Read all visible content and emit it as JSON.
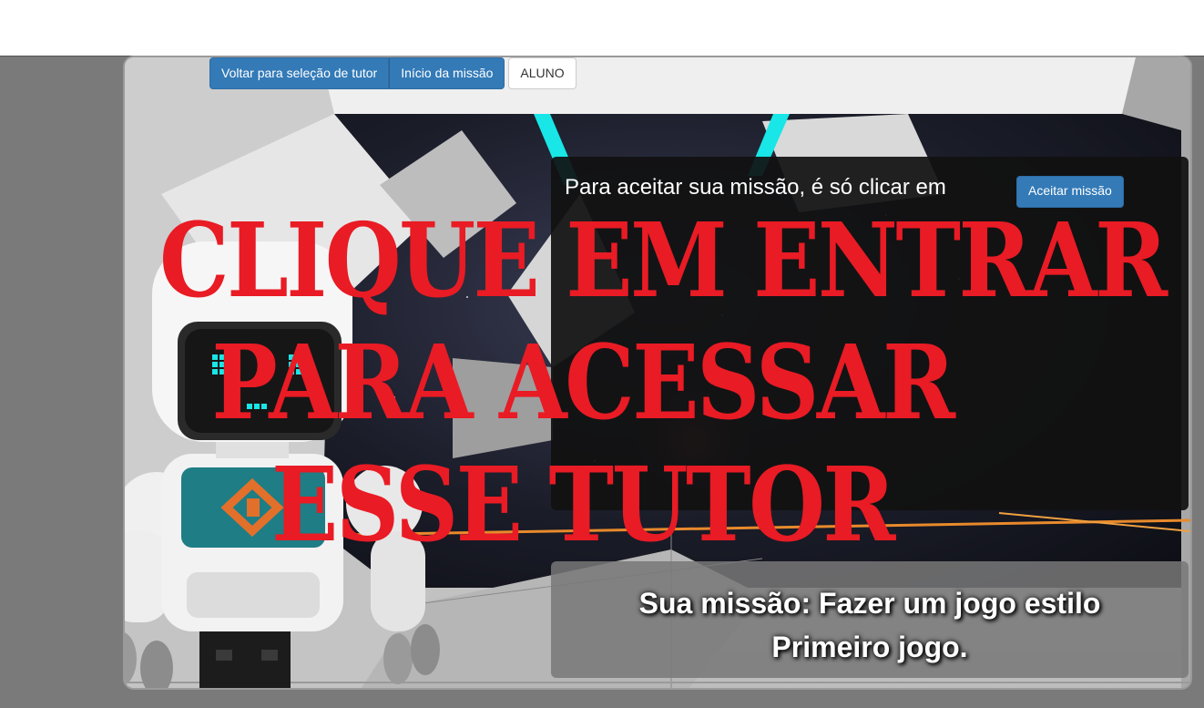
{
  "toolbar": {
    "back_label": "Voltar para seleção de tutor",
    "start_label": "Início da missão",
    "role_label": "ALUNO"
  },
  "accept": {
    "text": "Para aceitar sua missão, é só clicar em",
    "button_label": "Aceitar missão"
  },
  "mission": {
    "line1": "Sua missão: Fazer um jogo estilo",
    "line2": "Primeiro jogo."
  },
  "overlay": {
    "line1": "CLIQUE EM ENTRAR",
    "line2": "PARA ACESSAR",
    "line3": "ESSE TUTOR"
  },
  "colors": {
    "overlay_red": "#e91b24",
    "button_blue": "#337ab7",
    "robot_teal": "#1e7d85",
    "robot_eye": "#19e6e6",
    "laser_cyan": "#19e6e6"
  },
  "icons": {
    "robot": "robot-tutor-illustration",
    "logo": "tutor-logo-icon"
  }
}
